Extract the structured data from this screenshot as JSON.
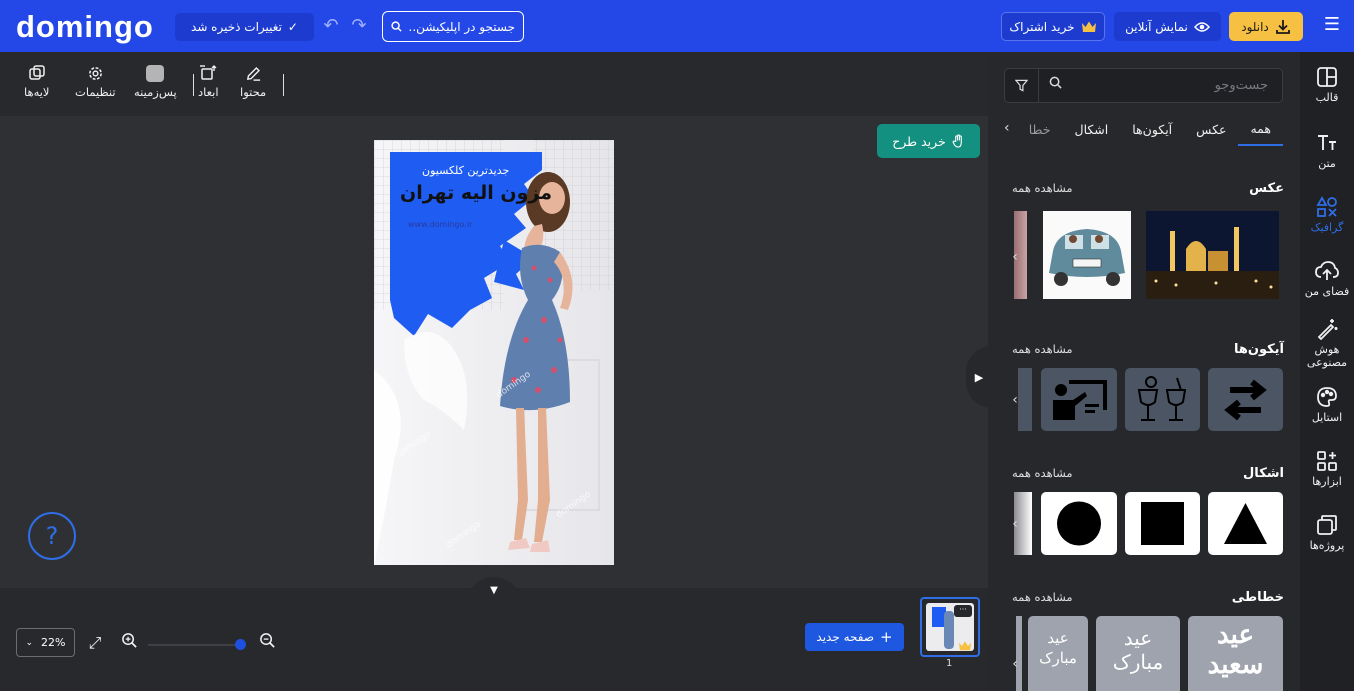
{
  "header": {
    "logo": "domingo",
    "saved_label": "تغییرات ذخیره شد",
    "search_placeholder": "جستجو در اپلیکیشن...",
    "subscribe_label": "خرید اشتراک",
    "online_label": "نمایش آنلاین",
    "download_label": "دانلود"
  },
  "toolbar": {
    "content": "محتوا",
    "dimensions": "ابعاد",
    "background": "پس‌زمینه",
    "settings": "تنظیمات",
    "layers": "لایه‌ها"
  },
  "canvas": {
    "buy_design": "خرید طرح",
    "help": "?",
    "design": {
      "heading_small": "جدیدترین کلکسیون",
      "heading_main": "مزون الیه تهران",
      "url": "www.domingo.ir",
      "watermark": "domingo"
    }
  },
  "bottom": {
    "zoom_value": "22%",
    "new_page": "صفحه جدید",
    "page_number": "1",
    "thumb_menu": "···"
  },
  "sidebar": {
    "search_placeholder": "جست‌وجو",
    "tabs": [
      "همه",
      "عکس",
      "آیکون‌ها",
      "اشکال",
      "خطا"
    ],
    "sections": [
      {
        "title": "عکس",
        "see_all": "مشاهده همه"
      },
      {
        "title": "آیکون‌ها",
        "see_all": "مشاهده همه"
      },
      {
        "title": "اشکال",
        "see_all": "مشاهده همه"
      },
      {
        "title": "خطاطی",
        "see_all": "مشاهده همه"
      }
    ],
    "calligraphy": [
      "عید سعید",
      "عید مبارک",
      "عید مبارک"
    ]
  },
  "rail": [
    {
      "label": "قالب",
      "icon": "template-icon"
    },
    {
      "label": "متن",
      "icon": "text-icon"
    },
    {
      "label": "گرافیک",
      "icon": "graphics-icon"
    },
    {
      "label": "فضای من",
      "icon": "upload-cloud-icon"
    },
    {
      "label": "هوش مصنوعی",
      "icon": "magic-wand-icon"
    },
    {
      "label": "استایل",
      "icon": "palette-icon"
    },
    {
      "label": "ابزارها",
      "icon": "tools-icon"
    },
    {
      "label": "پروژه‌ها",
      "icon": "projects-icon"
    }
  ],
  "colors": {
    "brand": "#2448e8",
    "download": "#f6c143",
    "buy": "#13907f",
    "active": "#2f6ee6"
  }
}
